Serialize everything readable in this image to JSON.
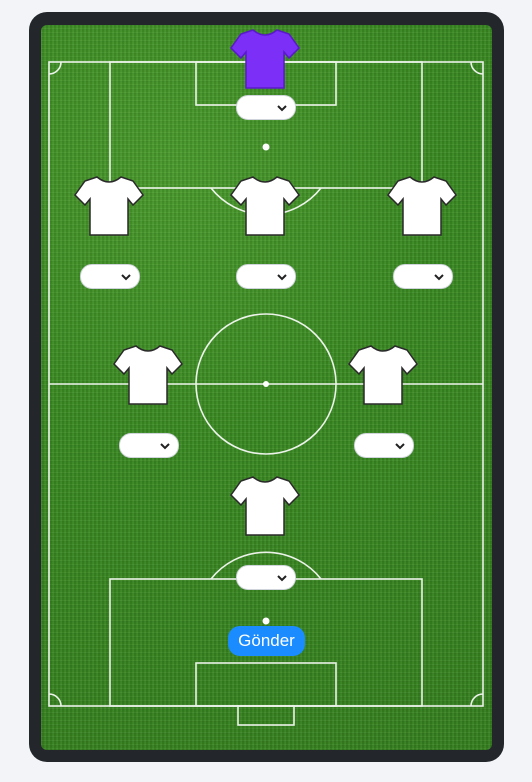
{
  "form": {
    "submit_label": "Gönder"
  },
  "colors": {
    "goalkeeper_shirt": "#7b2ff7",
    "player_shirt": "#ffffff",
    "pitch": "#3f8f26",
    "submit_button": "#1a8cff"
  },
  "positions": [
    {
      "id": "goalkeeper",
      "selected": ""
    },
    {
      "id": "left-back",
      "selected": ""
    },
    {
      "id": "center-back",
      "selected": ""
    },
    {
      "id": "right-back",
      "selected": ""
    },
    {
      "id": "left-midfielder",
      "selected": ""
    },
    {
      "id": "right-midfielder",
      "selected": ""
    },
    {
      "id": "forward",
      "selected": ""
    }
  ],
  "icons": {
    "shirt": "jersey-icon",
    "dropdown": "chevron-down-icon"
  }
}
